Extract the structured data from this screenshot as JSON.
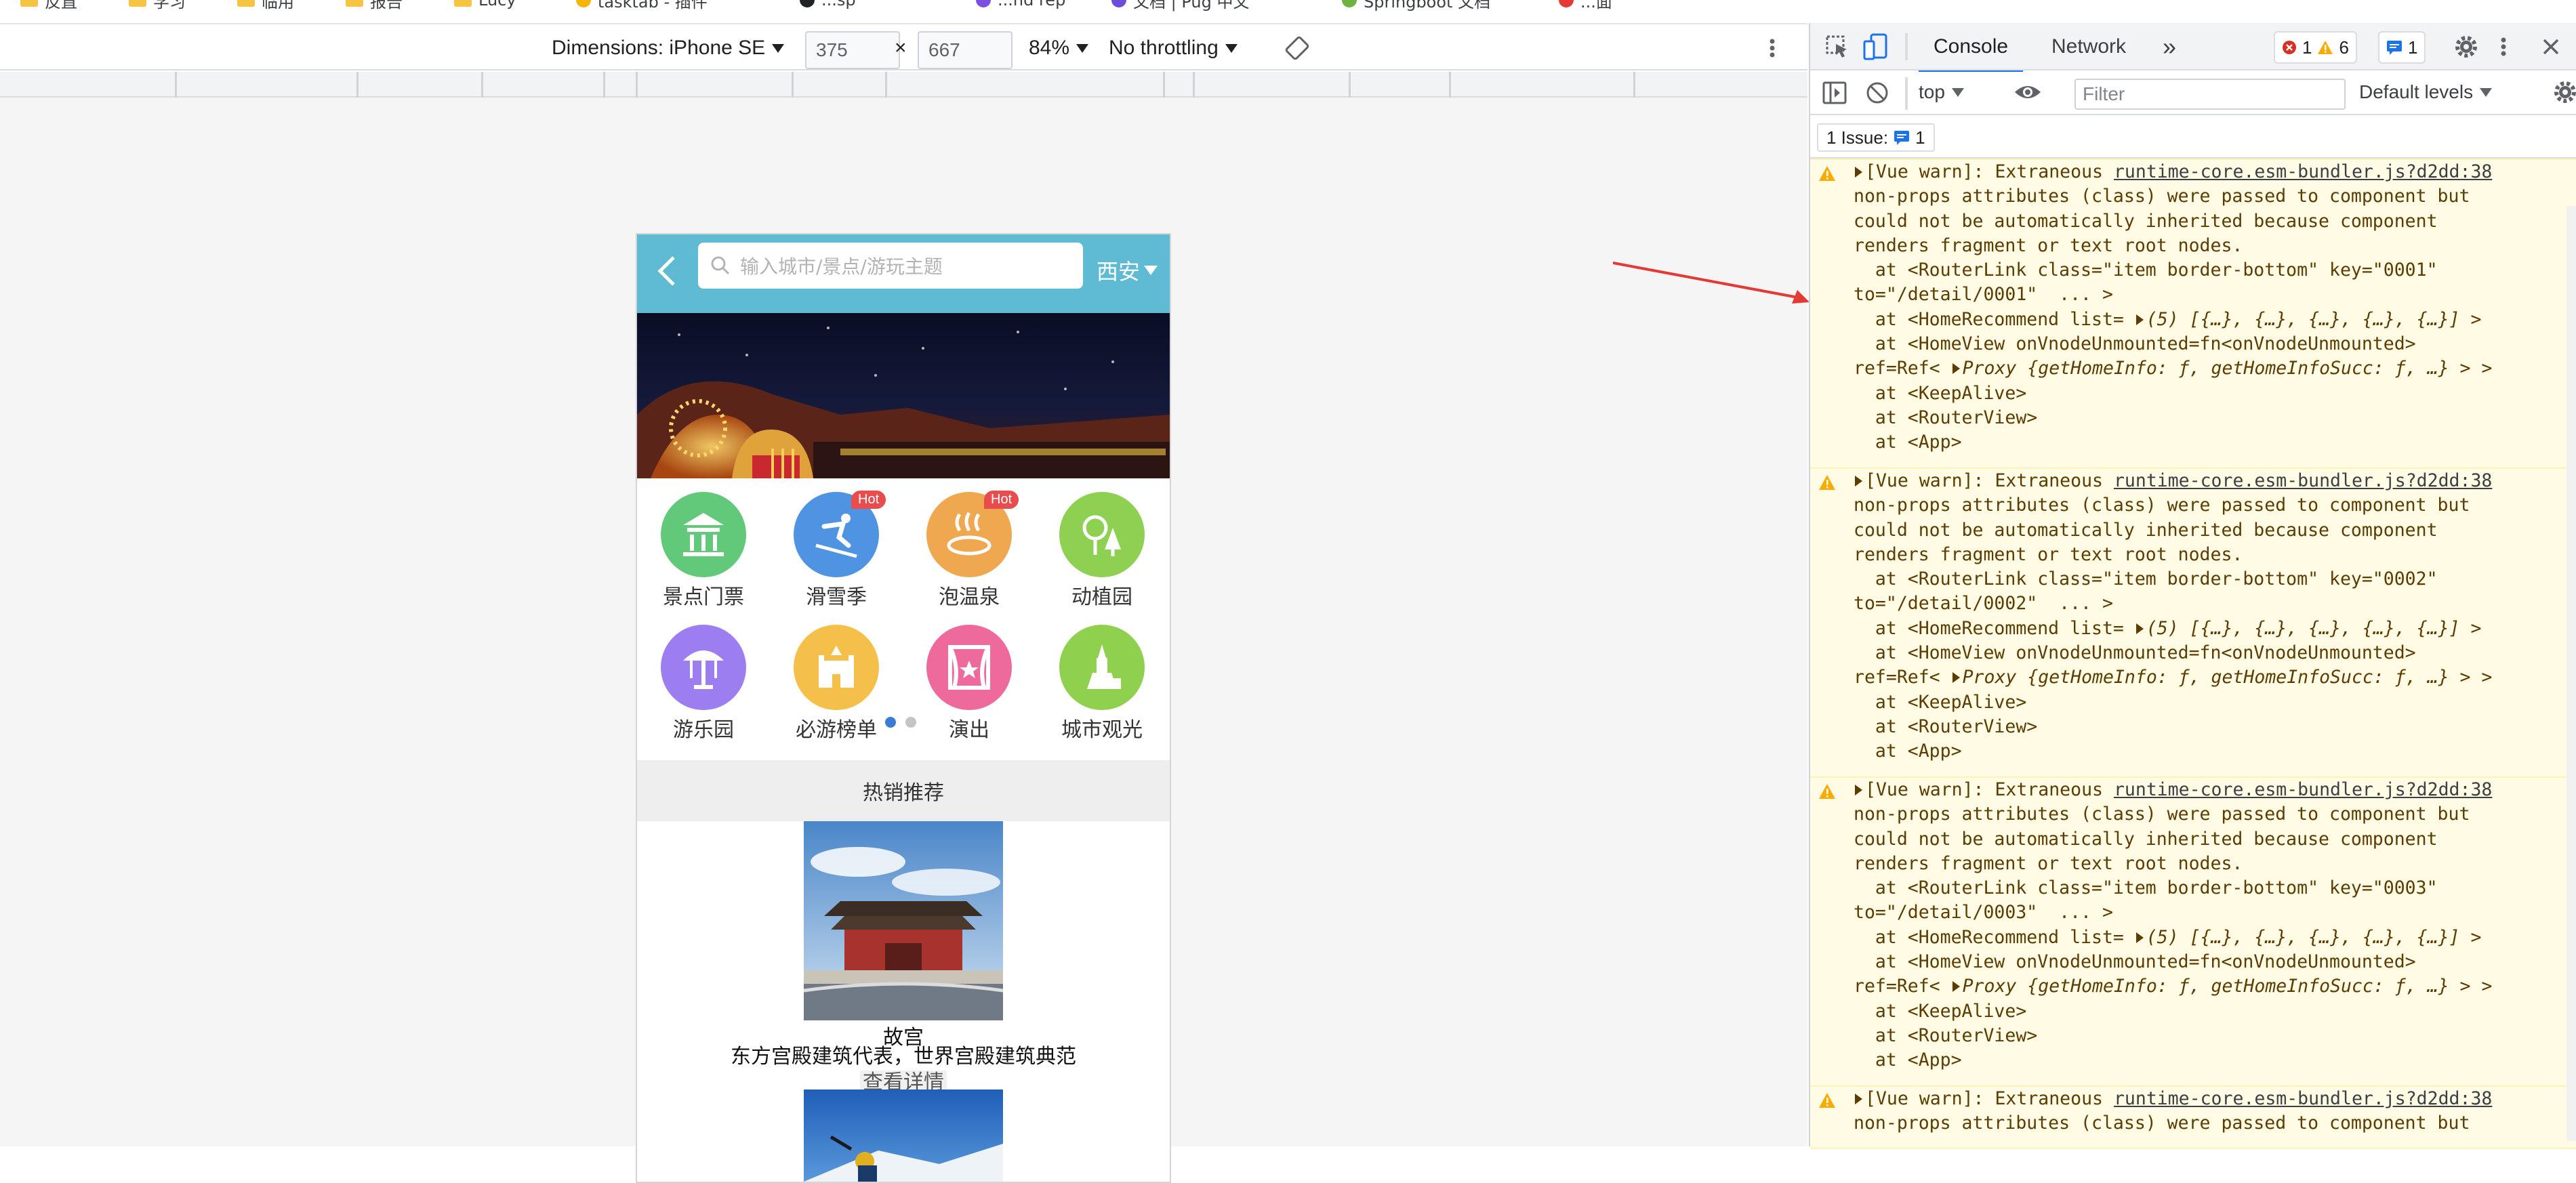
{
  "bookmarks": [
    "反直",
    "学习",
    "临用",
    "报告",
    "Lucy",
    "tasktab - 插件",
    "...sp",
    "...nd rep",
    "文档 | Pug 中文",
    "Springboot 文档",
    "...面"
  ],
  "device_toolbar": {
    "dimensions_label": "Dimensions: iPhone SE",
    "width": "375",
    "times": "×",
    "height": "667",
    "zoom": "84%",
    "throttling": "No throttling"
  },
  "mobile": {
    "search_placeholder": "输入城市/景点/游玩主题",
    "city": "西安",
    "categories": [
      {
        "label": "景点门票",
        "icon": "temple-icon",
        "color": "#63c97a",
        "hot": ""
      },
      {
        "label": "滑雪季",
        "icon": "ski-icon",
        "color": "#4f93e3",
        "hot": "Hot"
      },
      {
        "label": "泡温泉",
        "icon": "hot-spring-icon",
        "color": "#f0a850",
        "hot": "Hot"
      },
      {
        "label": "动植园",
        "icon": "tree-icon",
        "color": "#8ed052",
        "hot": ""
      },
      {
        "label": "游乐园",
        "icon": "carousel-icon",
        "color": "#9c7ef0",
        "hot": ""
      },
      {
        "label": "必游榜单",
        "icon": "castle-icon",
        "color": "#f5c04a",
        "hot": ""
      },
      {
        "label": "演出",
        "icon": "theater-icon",
        "color": "#ef6a9c",
        "hot": ""
      },
      {
        "label": "城市观光",
        "icon": "tower-icon",
        "color": "#8fd04e",
        "hot": ""
      }
    ],
    "hot_title": "热销推荐",
    "recommend": [
      {
        "title": "故宫",
        "desc": "东方宫殿建筑代表，世界宫殿建筑典范",
        "more": "查看详情"
      }
    ]
  },
  "devtools": {
    "tabs": [
      "Console",
      "Network"
    ],
    "more": "»",
    "errors": "1",
    "warnings": "6",
    "messages": "1",
    "context": "top",
    "filter_placeholder": "Filter",
    "levels": "Default levels",
    "issues_label": "1 Issue:",
    "issues_count": "1",
    "warnings_list": [
      {
        "head": "[Vue warn]: Extraneous ",
        "source": "runtime-core.esm-bundler.js?d2dd:38",
        "l2": "non-props attributes (class) were passed to component but",
        "l3": "could not be automatically inherited because component",
        "l4": "renders fragment or text root nodes.",
        "l5": "  at <RouterLink class=\"item border-bottom\" key=\"0001\"",
        "l6": "to=\"/detail/0001\"  ... >",
        "l7a": "  at <HomeRecommend list= ",
        "l7b": "(5) [{…}, {…}, {…}, {…}, {…}] >",
        "l8": "  at <HomeView onVnodeUnmounted=fn<onVnodeUnmounted>",
        "l9a": "ref=Ref< ",
        "l9b": "Proxy {getHomeInfo: ƒ, getHomeInfoSucc: ƒ, …} > >",
        "l10": "  at <KeepAlive>",
        "l11": "  at <RouterView>",
        "l12": "  at <App>"
      },
      {
        "head": "[Vue warn]: Extraneous ",
        "source": "runtime-core.esm-bundler.js?d2dd:38",
        "l2": "non-props attributes (class) were passed to component but",
        "l3": "could not be automatically inherited because component",
        "l4": "renders fragment or text root nodes.",
        "l5": "  at <RouterLink class=\"item border-bottom\" key=\"0002\"",
        "l6": "to=\"/detail/0002\"  ... >",
        "l7a": "  at <HomeRecommend list= ",
        "l7b": "(5) [{…}, {…}, {…}, {…}, {…}] >",
        "l8": "  at <HomeView onVnodeUnmounted=fn<onVnodeUnmounted>",
        "l9a": "ref=Ref< ",
        "l9b": "Proxy {getHomeInfo: ƒ, getHomeInfoSucc: ƒ, …} > >",
        "l10": "  at <KeepAlive>",
        "l11": "  at <RouterView>",
        "l12": "  at <App>"
      },
      {
        "head": "[Vue warn]: Extraneous ",
        "source": "runtime-core.esm-bundler.js?d2dd:38",
        "l2": "non-props attributes (class) were passed to component but",
        "l3": "could not be automatically inherited because component",
        "l4": "renders fragment or text root nodes.",
        "l5": "  at <RouterLink class=\"item border-bottom\" key=\"0003\"",
        "l6": "to=\"/detail/0003\"  ... >",
        "l7a": "  at <HomeRecommend list= ",
        "l7b": "(5) [{…}, {…}, {…}, {…}, {…}] >",
        "l8": "  at <HomeView onVnodeUnmounted=fn<onVnodeUnmounted>",
        "l9a": "ref=Ref< ",
        "l9b": "Proxy {getHomeInfo: ƒ, getHomeInfoSucc: ƒ, …} > >",
        "l10": "  at <KeepAlive>",
        "l11": "  at <RouterView>",
        "l12": "  at <App>"
      },
      {
        "head": "[Vue warn]: Extraneous ",
        "source": "runtime-core.esm-bundler.js?d2dd:38",
        "l2": "non-props attributes (class) were passed to component but"
      }
    ]
  },
  "colors": {
    "header": "#5fbad4",
    "accent": "#1a73e8",
    "warn_bg": "#fffbe5",
    "arrow": "#e53935"
  }
}
